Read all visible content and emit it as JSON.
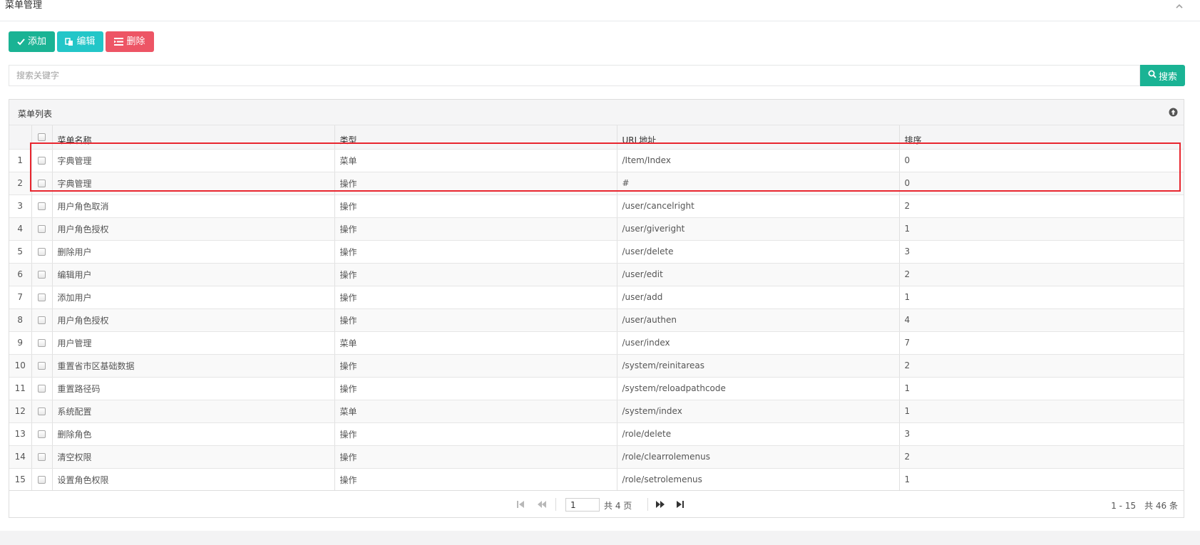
{
  "page": {
    "title": "菜单管理"
  },
  "toolbar": {
    "add_label": "添加",
    "edit_label": "编辑",
    "delete_label": "删除"
  },
  "search": {
    "placeholder": "搜索关键字",
    "value": "",
    "button_label": "搜索"
  },
  "grid": {
    "caption": "菜单列表",
    "columns": [
      "菜单名称",
      "类型",
      "URL地址",
      "排序"
    ],
    "rows": [
      {
        "n": "1",
        "name": "字典管理",
        "type": "菜单",
        "url": "/Item/Index",
        "sort": "0"
      },
      {
        "n": "2",
        "name": "字典管理",
        "type": "操作",
        "url": "#",
        "sort": "0"
      },
      {
        "n": "3",
        "name": "用户角色取消",
        "type": "操作",
        "url": "/user/cancelright",
        "sort": "2"
      },
      {
        "n": "4",
        "name": "用户角色授权",
        "type": "操作",
        "url": "/user/giveright",
        "sort": "1"
      },
      {
        "n": "5",
        "name": "删除用户",
        "type": "操作",
        "url": "/user/delete",
        "sort": "3"
      },
      {
        "n": "6",
        "name": "编辑用户",
        "type": "操作",
        "url": "/user/edit",
        "sort": "2"
      },
      {
        "n": "7",
        "name": "添加用户",
        "type": "操作",
        "url": "/user/add",
        "sort": "1"
      },
      {
        "n": "8",
        "name": "用户角色授权",
        "type": "操作",
        "url": "/user/authen",
        "sort": "4"
      },
      {
        "n": "9",
        "name": "用户管理",
        "type": "菜单",
        "url": "/user/index",
        "sort": "7"
      },
      {
        "n": "10",
        "name": "重置省市区基础数据",
        "type": "操作",
        "url": "/system/reinitareas",
        "sort": "2"
      },
      {
        "n": "11",
        "name": "重置路径码",
        "type": "操作",
        "url": "/system/reloadpathcode",
        "sort": "1"
      },
      {
        "n": "12",
        "name": "系统配置",
        "type": "菜单",
        "url": "/system/index",
        "sort": "1"
      },
      {
        "n": "13",
        "name": "删除角色",
        "type": "操作",
        "url": "/role/delete",
        "sort": "3"
      },
      {
        "n": "14",
        "name": "清空权限",
        "type": "操作",
        "url": "/role/clearrolemenus",
        "sort": "2"
      },
      {
        "n": "15",
        "name": "设置角色权限",
        "type": "操作",
        "url": "/role/setrolemenus",
        "sort": "1"
      }
    ]
  },
  "pager": {
    "current_page": "1",
    "total_pages_text": "共 4 页",
    "record_info": "1 - 15　共 46 条"
  },
  "colors": {
    "primary": "#1ab394",
    "info": "#23c6c8",
    "danger": "#ed5565",
    "highlight": "#e8262f"
  },
  "icons": [
    "check-icon",
    "copy-icon",
    "list-remove-icon",
    "search-icon",
    "chevron-up-icon",
    "circle-up-icon",
    "first-page-icon",
    "prev-page-icon",
    "next-page-icon",
    "last-page-icon"
  ]
}
